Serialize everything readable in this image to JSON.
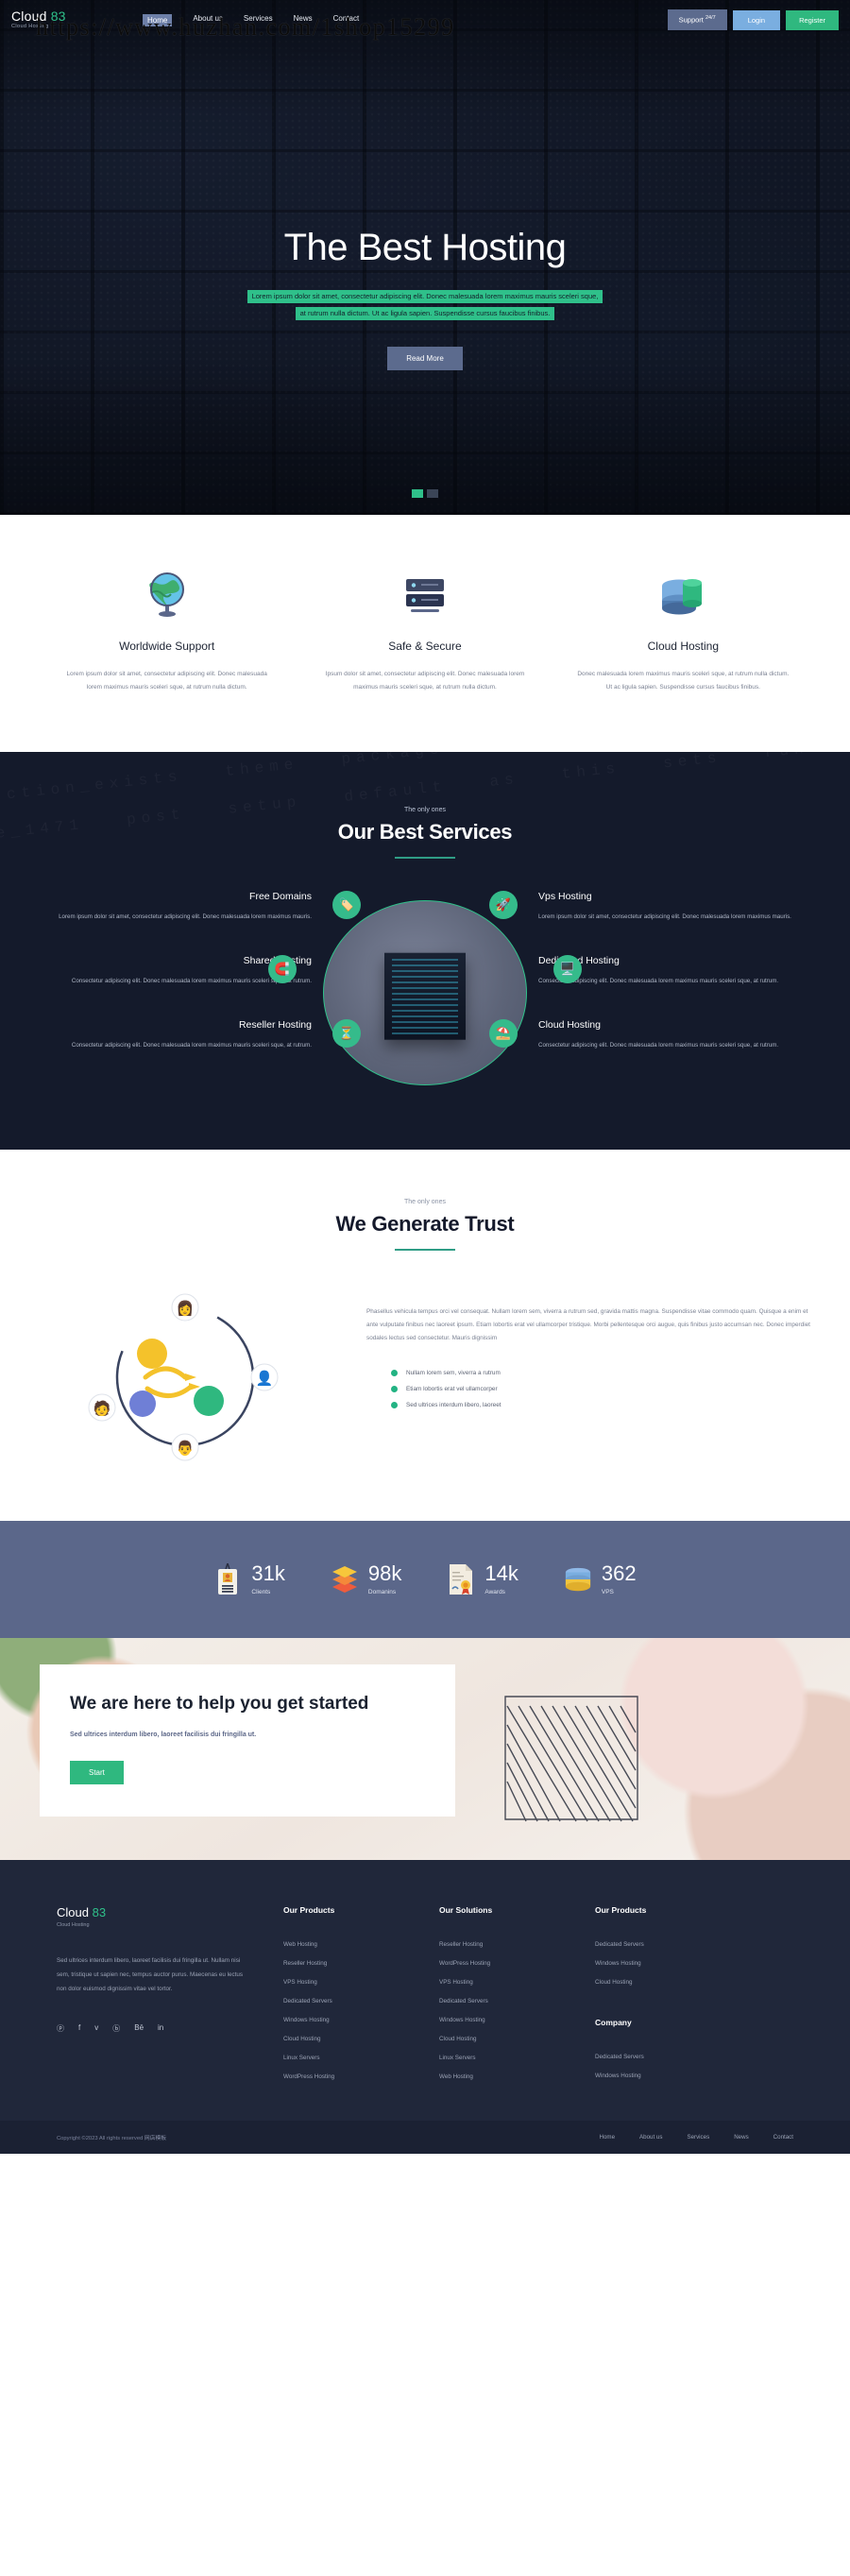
{
  "brand": {
    "name": "Cloud",
    "accent": "83",
    "tagline": "Cloud Hosting",
    "accent_color": "#2fc08a"
  },
  "watermark": "https://www.huzhan.com/1shop15299",
  "nav": {
    "items": [
      {
        "label": "Home",
        "active": true
      },
      {
        "label": "About us",
        "active": false
      },
      {
        "label": "Services",
        "active": false
      },
      {
        "label": "News",
        "active": false
      },
      {
        "label": "Contact",
        "active": false
      }
    ]
  },
  "header_actions": {
    "support_label": "Support",
    "support_sup": "24/7",
    "login_label": "Login",
    "register_label": "Register"
  },
  "hero": {
    "title": "The Best Hosting",
    "sub_line1": "Lorem ipsum dolor sit amet, consectetur adipiscing elit. Donec malesuada lorem maximus mauris sceleri sque,",
    "sub_line2": "at rutrum nulla dictum. Ut ac ligula sapien. Suspendisse cursus faucibus finibus.",
    "button": "Read More"
  },
  "features": [
    {
      "icon": "globe-icon",
      "title": "Worldwide Support",
      "text": "Lorem ipsum dolor sit amet, consectetur adipiscing elit. Donec malesuada lorem maximus mauris sceleri sque, at rutrum nulla dictum."
    },
    {
      "icon": "server-shield-icon",
      "title": "Safe & Secure",
      "text": "Ipsum dolor sit amet, consectetur adipiscing elit. Donec malesuada lorem maximus mauris sceleri sque, at rutrum nulla dictum."
    },
    {
      "icon": "database-icon",
      "title": "Cloud Hosting",
      "text": "Donec malesuada lorem maximus mauris sceleri sque, at rutrum nulla dictum. Ut ac ligula sapien. Suspendisse cursus faucibus finibus."
    }
  ],
  "services": {
    "eyebrow": "The only ones",
    "title": "Our Best Services",
    "items": [
      {
        "side": "left",
        "title": "Free Domains",
        "text": "Lorem ipsum dolor sit amet, consectetur adipiscing elit. Donec malesuada lorem maximus mauris.",
        "icon": "tag-icon"
      },
      {
        "side": "right",
        "title": "Vps Hosting",
        "text": "Lorem ipsum dolor sit amet, consectetur adipiscing elit. Donec malesuada lorem maximus mauris.",
        "icon": "rocket-icon"
      },
      {
        "side": "left",
        "title": "Shared Hosting",
        "text": "Consectetur adipiscing elit. Donec malesuada lorem maximus mauris sceleri sque, at rutrum.",
        "icon": "magnet-icon"
      },
      {
        "side": "right",
        "title": "Dedicated Hosting",
        "text": "Consectetur adipiscing elit. Donec malesuada lorem maximus mauris sceleri sque, at rutrum.",
        "icon": "server-icon"
      },
      {
        "side": "left",
        "title": "Reseller Hosting",
        "text": "Consectetur adipiscing elit. Donec malesuada lorem maximus mauris sceleri sque, at rutrum.",
        "icon": "hourglass-icon"
      },
      {
        "side": "right",
        "title": "Cloud Hosting",
        "text": "Consectetur adipiscing elit. Donec malesuada lorem maximus mauris sceleri sque, at rutrum.",
        "icon": "umbrella-icon"
      }
    ]
  },
  "trust": {
    "eyebrow": "The only ones",
    "title": "We Generate Trust",
    "paragraph": "Phasellus vehicula tempus orci vel consequat. Nullam lorem sem, viverra a rutrum sed, gravida mattis magna. Suspendisse vitae commodo quam. Quisque a enim et ante vulputate finibus nec laoreet ipsum. Etiam lobortis erat vel ullamcorper tristique. Morbi pellentesque orci augue, quis finibus justo accumsan nec. Donec imperdiet sodales lectus sed consectetur. Mauris dignissim",
    "bullets": [
      "Nullam lorem sem, viverra a rutrum",
      "Etiam lobortis erat vel ullamcorper",
      "Sed ultrices interdum libero, laoreet"
    ]
  },
  "stats": [
    {
      "icon": "id-card-icon",
      "value": "31k",
      "label": "Clients"
    },
    {
      "icon": "layers-icon",
      "value": "98k",
      "label": "Domanins"
    },
    {
      "icon": "award-icon",
      "value": "14k",
      "label": "Awards"
    },
    {
      "icon": "database-icon",
      "value": "362",
      "label": "VPS"
    }
  ],
  "cta": {
    "title": "We are here to help you get started",
    "subtitle": "Sed ultrices interdum libero, laoreet facilisis dui fringilla ut.",
    "button": "Start"
  },
  "footer": {
    "description": "Sed ultrices interdum libero, laoreet facilisis dui fringilla ut. Nullam nisi sem, tristique ut sapien nec, tempus auctor purus. Maecenas eu lectus non dolor euismod dignissim vitae vel tortor.",
    "social": [
      {
        "icon": "pinterest-icon",
        "glyph": "ⓟ"
      },
      {
        "icon": "facebook-icon",
        "glyph": "f"
      },
      {
        "icon": "twitter-icon",
        "glyph": "ᴠ"
      },
      {
        "icon": "dribbble-icon",
        "glyph": "ⓑ"
      },
      {
        "icon": "behance-icon",
        "glyph": "Bē"
      },
      {
        "icon": "linkedin-icon",
        "glyph": "in"
      }
    ],
    "columns": [
      {
        "title": "Our Products",
        "links": [
          "Web Hosting",
          "Reseller Hosting",
          "VPS Hosting",
          "Dedicated Servers",
          "Windows Hosting",
          "Cloud Hosting",
          "Linux Servers",
          "WordPress Hosting"
        ]
      },
      {
        "title": "Our Solutions",
        "links": [
          "Reseller Hosting",
          "WordPress Hosting",
          "VPS Hosting",
          "Dedicated Servers",
          "Windows Hosting",
          "Cloud Hosting",
          "Linux Servers",
          "Web Hosting"
        ]
      },
      {
        "title": "Our Products",
        "links": [
          "Dedicated Servers",
          "Windows Hosting",
          "Cloud Hosting"
        ],
        "title2": "Company",
        "links2": [
          "Dedicated Servers",
          "Windows Hosting"
        ]
      }
    ],
    "copyright": "Copyright ©2023 All rights reserved ",
    "copyright_cn": "网店模板",
    "bottom_nav": [
      "Home",
      "About us",
      "Services",
      "News",
      "Contact"
    ]
  }
}
